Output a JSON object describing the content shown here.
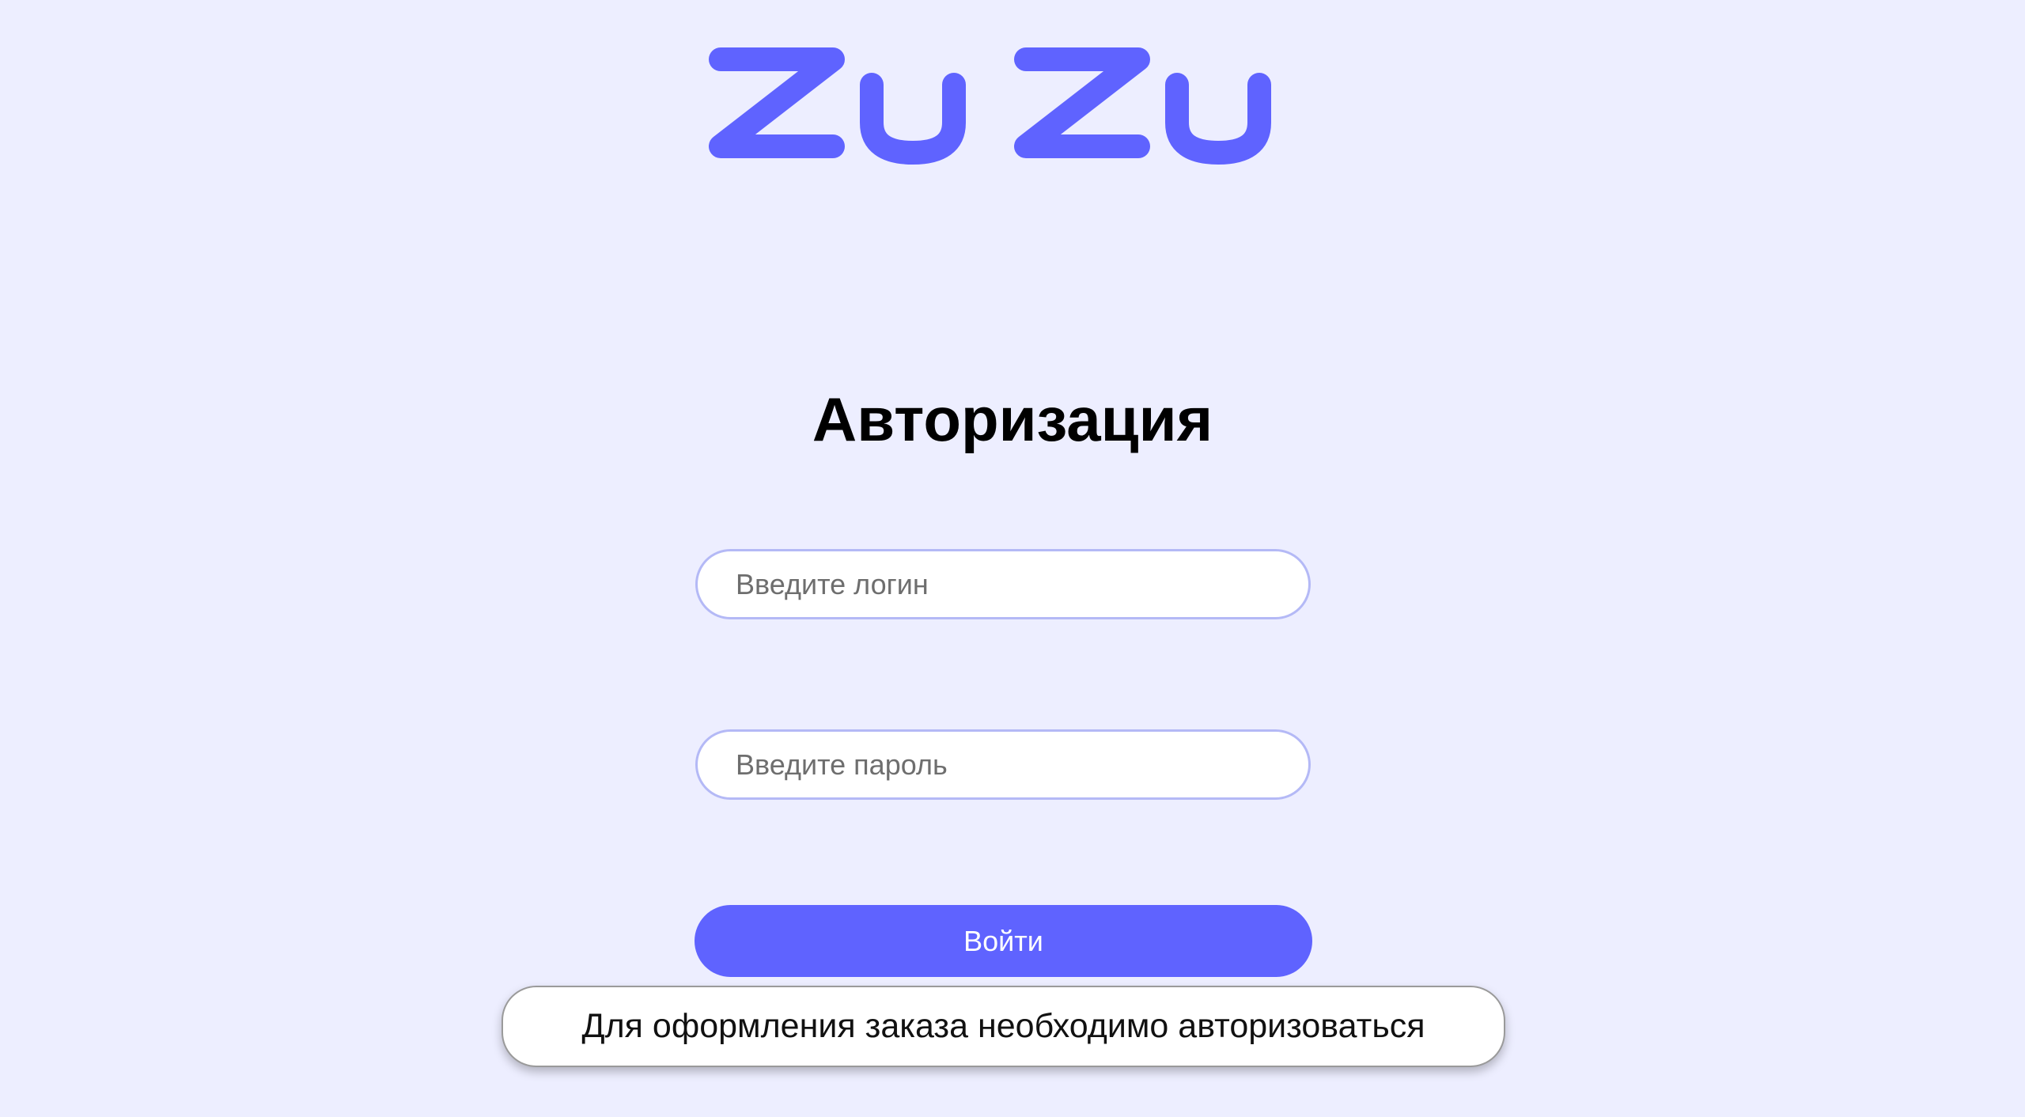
{
  "brand": {
    "name": "ZuZu",
    "color": "#5F63FF"
  },
  "colors": {
    "background": "#EDEEFF",
    "accent": "#5F63FF",
    "input_border": "#B4B9F6"
  },
  "auth": {
    "title": "Авторизация",
    "login_placeholder": "Введите логин",
    "password_placeholder": "Введите пароль",
    "submit_label": "Войти"
  },
  "toast": {
    "message": "Для оформления заказа необходимо авторизоваться"
  }
}
